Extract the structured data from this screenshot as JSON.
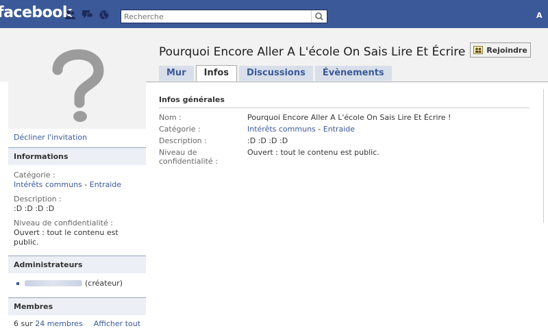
{
  "topbar": {
    "logo": "facebook",
    "search_placeholder": "Recherche",
    "account_initial": "A",
    "icons": [
      "friends-icon",
      "messages-icon",
      "notifications-globe-icon",
      "search-icon"
    ]
  },
  "group": {
    "title": "Pourquoi Encore Aller A L'école On Sais Lire Et Écrire !",
    "join_label": "Rejoindre"
  },
  "tabs": [
    {
      "label": "Mur",
      "active": false
    },
    {
      "label": "Infos",
      "active": true
    },
    {
      "label": "Discussions",
      "active": false
    },
    {
      "label": "Évènements",
      "active": false
    }
  ],
  "sidebar": {
    "decline": "Décliner l'invitation",
    "informations": {
      "header": "Informations",
      "category_label": "Catégorie :",
      "category_1": "Intérêts communs",
      "separator": " - ",
      "category_2": "Entraide",
      "description_label": "Description :",
      "description": ":D :D :D :D",
      "privacy_label": "Niveau de confidentialité :",
      "privacy": "Ouvert : tout le contenu est public."
    },
    "admins": {
      "header": "Administrateurs",
      "role": "(créateur)"
    },
    "members": {
      "header": "Membres",
      "count_prefix": "6 sur ",
      "count_link": "24 membres",
      "show_all": "Afficher tout"
    }
  },
  "info": {
    "header": "Infos générales",
    "name_label": "Nom :",
    "name": "Pourquoi Encore Aller A L'école On Sais Lire Et Écrire !",
    "category_label": "Catégorie :",
    "category_1": "Intérêts communs",
    "separator": " - ",
    "category_2": "Entraide",
    "description_label": "Description :",
    "description": ":D :D :D :D",
    "privacy_label": "Niveau de confidentialité :",
    "privacy": "Ouvert : tout le contenu est public."
  },
  "colors": {
    "brand": "#3b5998",
    "tab_bg": "#d8dfea",
    "section_bg": "#eceff5"
  }
}
